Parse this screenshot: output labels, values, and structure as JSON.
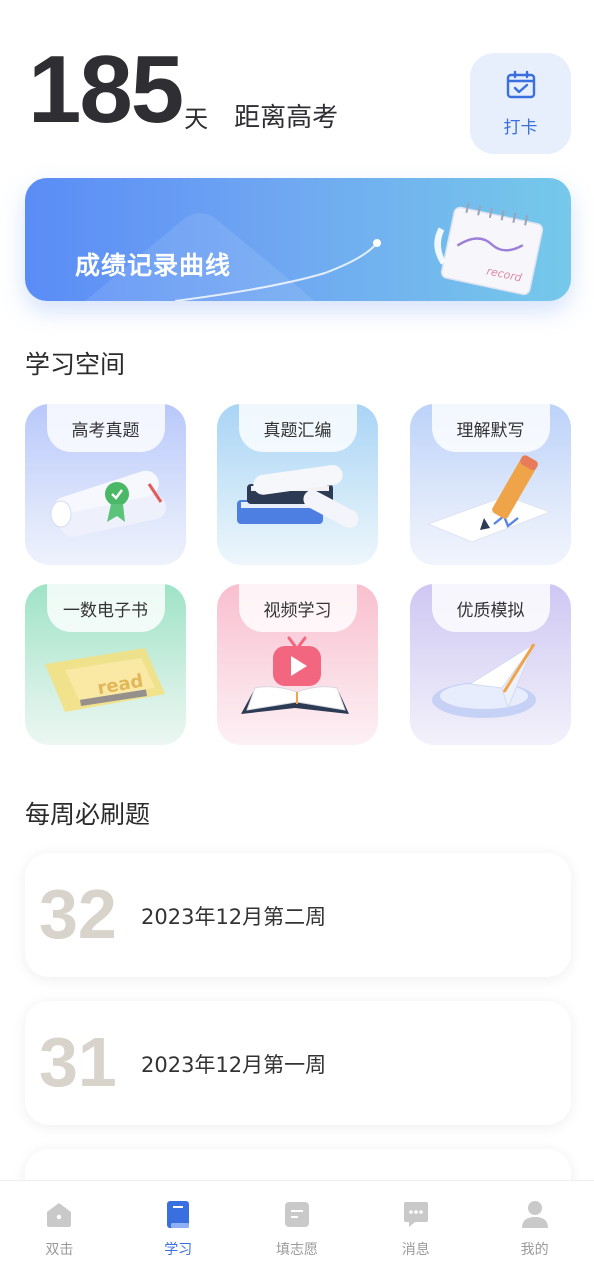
{
  "countdown": {
    "days": "185",
    "unit": "天",
    "label": "距离高考"
  },
  "checkin": {
    "icon": "calendar-check-icon",
    "label": "打卡"
  },
  "banner": {
    "title": "成绩记录曲线",
    "notebook_text": "record"
  },
  "study": {
    "title": "学习空间",
    "tiles": [
      {
        "label": "高考真题",
        "icon": "scroll-certificate-icon"
      },
      {
        "label": "真题汇编",
        "icon": "books-stack-icon"
      },
      {
        "label": "理解默写",
        "icon": "pencil-paper-icon"
      },
      {
        "label": "一数电子书",
        "icon": "ebook-read-icon",
        "art_text": "read"
      },
      {
        "label": "视频学习",
        "icon": "video-book-icon"
      },
      {
        "label": "优质模拟",
        "icon": "paper-plane-icon"
      }
    ]
  },
  "weekly": {
    "title": "每周必刷题",
    "items": [
      {
        "num": "32",
        "text": "2023年12月第二周"
      },
      {
        "num": "31",
        "text": "2023年12月第一周"
      }
    ]
  },
  "tabbar": {
    "items": [
      {
        "label": "双击",
        "icon": "home-icon",
        "active": false
      },
      {
        "label": "学习",
        "icon": "book-icon",
        "active": true
      },
      {
        "label": "填志愿",
        "icon": "form-icon",
        "active": false
      },
      {
        "label": "消息",
        "icon": "message-icon",
        "active": false
      },
      {
        "label": "我的",
        "icon": "user-icon",
        "active": false
      }
    ]
  },
  "colors": {
    "accent": "#3a6fe0",
    "text": "#2b2b2b",
    "muted": "#9a9a9a"
  }
}
